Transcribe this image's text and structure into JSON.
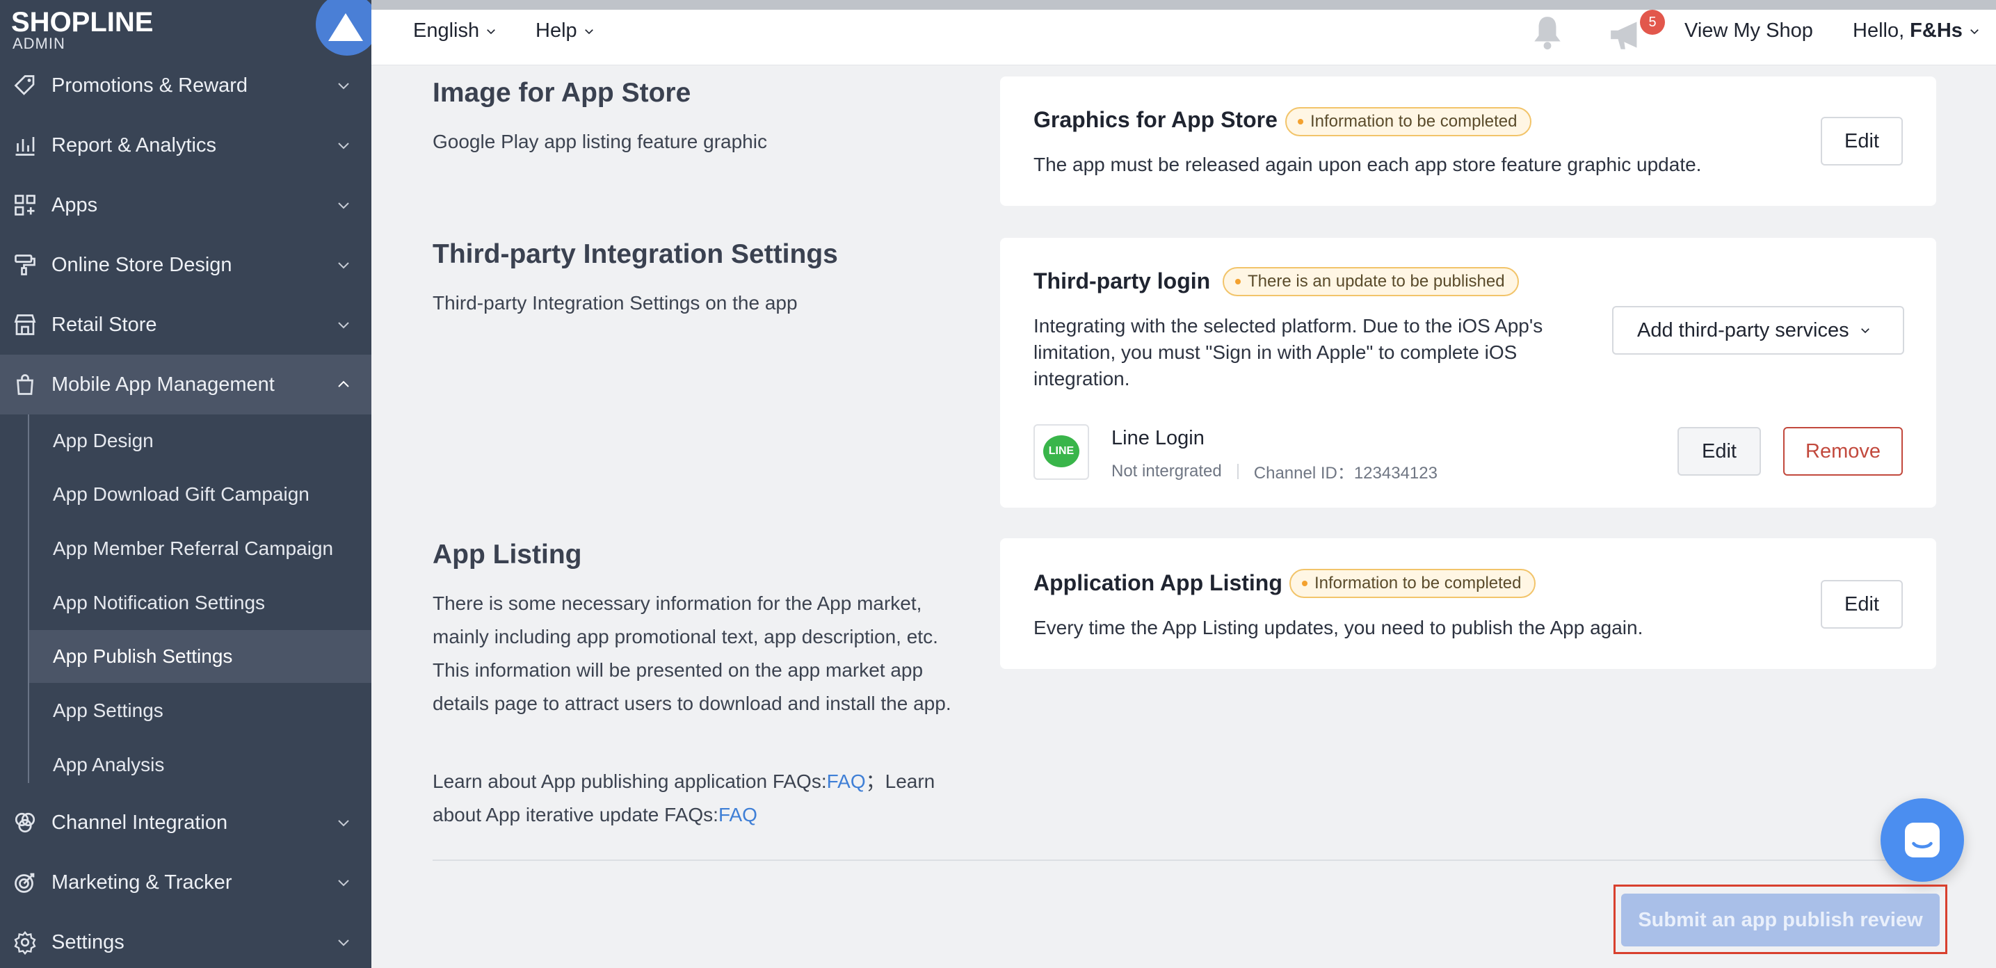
{
  "brand": {
    "name": "SHOPLINE",
    "sub": "ADMIN"
  },
  "sidebar": {
    "items": [
      {
        "label": "Promotions & Reward",
        "icon": "tag-icon"
      },
      {
        "label": "Report & Analytics",
        "icon": "chart-icon"
      },
      {
        "label": "Apps",
        "icon": "apps-grid-icon"
      },
      {
        "label": "Online Store Design",
        "icon": "paint-roller-icon"
      },
      {
        "label": "Retail Store",
        "icon": "store-icon"
      },
      {
        "label": "Mobile App Management",
        "icon": "shopping-bag-icon"
      },
      {
        "label": "Channel Integration",
        "icon": "channels-icon"
      },
      {
        "label": "Marketing & Tracker",
        "icon": "target-icon"
      },
      {
        "label": "Settings",
        "icon": "gear-icon"
      }
    ],
    "subitems": [
      "App Design",
      "App Download Gift Campaign",
      "App Member Referral Campaign",
      "App Notification Settings",
      "App Publish Settings",
      "App Settings",
      "App Analysis"
    ]
  },
  "topbar": {
    "language": "English",
    "help": "Help",
    "notification_count": "5",
    "view_shop": "View My Shop",
    "greeting": "Hello,",
    "user": "F&Hs"
  },
  "sections": {
    "image_store": {
      "title": "Image for App Store",
      "desc": "Google Play app listing feature graphic"
    },
    "third_party": {
      "title": "Third-party Integration Settings",
      "desc": "Third-party Integration Settings on the app"
    },
    "app_listing": {
      "title": "App Listing",
      "desc": "There is some necessary information for the App market, mainly including app promotional text, app description, etc. This information will be presented on the app market app details page to attract users to download and install the app.",
      "faq_text1": "Learn about App publishing application FAQs:",
      "faq_link1": "FAQ",
      "faq_text2": "；Learn about App iterative update FAQs:",
      "faq_link2": "FAQ"
    }
  },
  "cards": {
    "graphics": {
      "title": "Graphics for App Store",
      "tag": "Information to be completed",
      "text": "The app must be released again upon each app store feature graphic update.",
      "edit": "Edit"
    },
    "login": {
      "title": "Third-party login",
      "tag": "There is an update to be published",
      "text": "Integrating with the selected platform. Due to the iOS App's limitation, you must \"Sign in with Apple\" to complete iOS integration.",
      "add_button": "Add third-party services",
      "provider_logo": "LINE",
      "provider_name": "Line Login",
      "provider_status": "Not intergrated",
      "channel": "Channel ID：123434123",
      "edit": "Edit",
      "remove": "Remove"
    },
    "listing": {
      "title": "Application App Listing",
      "tag": "Information to be completed",
      "text": "Every time the App Listing updates, you need to publish the App again.",
      "edit": "Edit"
    }
  },
  "submit_label": "Submit an app publish review"
}
